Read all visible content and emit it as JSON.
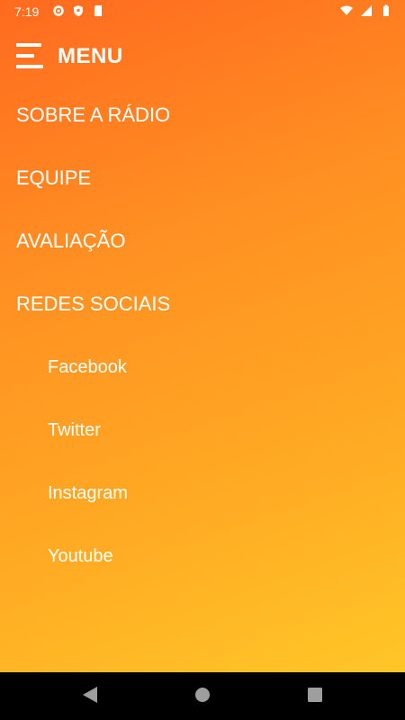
{
  "status_bar": {
    "time": "7:19",
    "icons_left": [
      "gear-icon",
      "shield-icon",
      "sd-card-icon"
    ],
    "icons_right": [
      "wifi-icon",
      "signal-icon",
      "battery-icon"
    ]
  },
  "header": {
    "title": "MENU"
  },
  "menu": {
    "items": [
      {
        "label": "SOBRE A RÁDIO"
      },
      {
        "label": "EQUIPE"
      },
      {
        "label": "AVALIAÇÃO"
      },
      {
        "label": "REDES SOCIAIS"
      }
    ],
    "social": [
      {
        "label": "Facebook"
      },
      {
        "label": "Twitter"
      },
      {
        "label": "Instagram"
      },
      {
        "label": "Youtube"
      }
    ]
  },
  "colors": {
    "gradient_top": "#ff6a1f",
    "gradient_bottom": "#ffc627",
    "text": "#ffffff"
  },
  "nav_bar": {
    "icons": [
      "back-icon",
      "home-icon",
      "recents-icon"
    ]
  }
}
